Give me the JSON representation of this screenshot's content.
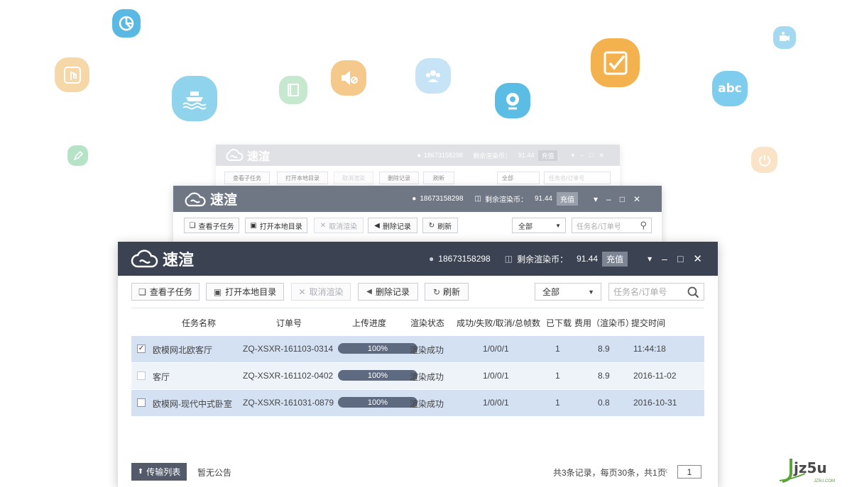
{
  "brand": {
    "name": "速渲",
    "watermark": "jz5u",
    "watermark_sub": "JZ5U.COM"
  },
  "back_window": {
    "user_id": "18673158298",
    "credit_label": "剩余渲染币：",
    "credit_value": "91.44",
    "recharge": "充值",
    "toolbar": [
      "查看子任务",
      "打开本地目录",
      "取消渲染",
      "删除记录",
      "刷新"
    ],
    "filter": "全部",
    "search_placeholder": "任务名/订单号"
  },
  "mid_window": {
    "user_id": "18673158298",
    "credit_label": "剩余渲染币：",
    "credit_value": "91.44",
    "recharge": "充值",
    "toolbar": [
      "查看子任务",
      "打开本地目录",
      "取消渲染",
      "删除记录",
      "刷新"
    ],
    "filter": "全部",
    "search_placeholder": "任务名/订单号"
  },
  "main_window": {
    "user_id": "18673158298",
    "credit_label": "剩余渲染币：",
    "credit_value": "91.44",
    "recharge": "充值",
    "toolbar": {
      "view_subtasks": "查看子任务",
      "open_local_dir": "打开本地目录",
      "cancel_render": "取消渲染",
      "delete_record": "删除记录",
      "refresh": "刷新"
    },
    "filter": "全部",
    "search_placeholder": "任务名/订单号",
    "columns": [
      "任务名称",
      "订单号",
      "上传进度",
      "渲染状态",
      "成功/失败/取消/总帧数",
      "已下载",
      "费用（渲染币）",
      "提交时间"
    ],
    "rows": [
      {
        "checked": true,
        "name": "欧模网北欧客厅",
        "order": "ZQ-XSXR-161103-0314",
        "progress": "100%",
        "status": "渲染成功",
        "frames": "1/0/0/1",
        "downloaded": "1",
        "cost": "8.9",
        "time": "11:44:18"
      },
      {
        "checked": false,
        "name": "客厅",
        "order": "ZQ-XSXR-161102-0402",
        "progress": "100%",
        "status": "渲染成功",
        "frames": "1/0/0/1",
        "downloaded": "1",
        "cost": "8.9",
        "time": "2016-11-02"
      },
      {
        "checked": false,
        "name": "欧模网-现代中式卧室",
        "order": "ZQ-XSXR-161031-0879",
        "progress": "100%",
        "status": "渲染成功",
        "frames": "1/0/0/1",
        "downloaded": "1",
        "cost": "0.8",
        "time": "2016-10-31"
      }
    ],
    "footer": {
      "transfer_list": "传输列表",
      "notice": "暂无公告",
      "summary": "共3条记录，每页30条，共1页",
      "page": "1"
    }
  },
  "colors": {
    "titlebar_main": "#3b4251",
    "titlebar_mid": "#707784",
    "titlebar_back": "#c6c9cf",
    "row_selected": "#d4e1f3",
    "row_alt": "#eef3fa",
    "progress": "#5e6a80"
  },
  "floating_icons": [
    "pie-chart-icon",
    "touch-icon",
    "ship-icon",
    "notebook-icon",
    "mute-icon",
    "group-icon",
    "webcam-icon",
    "checkbox-icon",
    "abc-icon",
    "camera-icon",
    "power-icon",
    "pencil-icon"
  ]
}
